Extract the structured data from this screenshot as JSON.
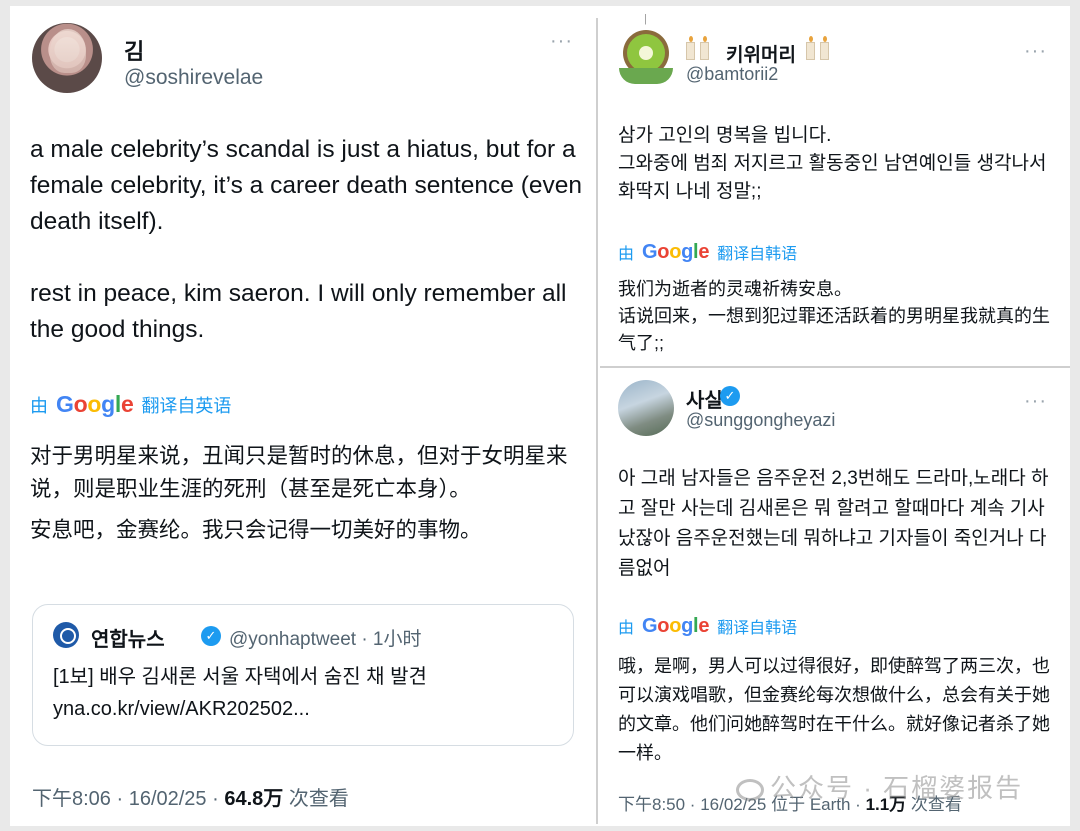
{
  "left_tweet": {
    "name": "김",
    "handle": "@soshirevelae",
    "more": "···",
    "body_en": [
      "a male celebrity’s scandal is just a hiatus, but for a female celebrity, it’s a career death sentence (even death itself).",
      "rest in peace, kim saeron. I will only remember all the good things."
    ],
    "translate_by": "由",
    "translate_from": "翻译自英语",
    "body_zh": [
      "对于男明星来说，丑闻只是暂时的休息，但对于女明星来说，则是职业生涯的死刑（甚至是死亡本身）。",
      "安息吧，金赛纶。我只会记得一切美好的事物。"
    ],
    "quote": {
      "name": "연합뉴스",
      "handle_time": "@yonhaptweet · 1小时",
      "line1": "[1보] 배우 김새론 서울 자택에서 숨진 채 발견",
      "line2": "yna.co.kr/view/AKR202502..."
    },
    "meta_time": "下午8:06 · 16/02/25 · ",
    "meta_views": "64.8万",
    "meta_views_label": " 次查看"
  },
  "right_top_tweet": {
    "name": "키위머리",
    "handle": "@bamtorii2",
    "more": "···",
    "body_ko": "삼가 고인의 명복을 빕니다.\n그와중에 범죄 저지르고 활동중인 남연예인들 생각나서 화딱지 나네 정말;;",
    "translate_by": "由",
    "translate_from": "翻译自韩语",
    "body_zh": "我们为逝者的灵魂祈祷安息。\n话说回来，一想到犯过罪还活跃着的男明星我就真的生气了;;"
  },
  "right_bottom_tweet": {
    "name": "사실",
    "handle": "@sunggongheyazi",
    "more": "···",
    "body_ko": "아 그래 남자들은 음주운전 2,3번해도 드라마,노래다 하고 잘만 사는데 김새론은 뭐 할려고 할때마다 계속 기사났잖아 음주운전했는데 뭐하냐고 기자들이 죽인거나 다름없어",
    "translate_by": "由",
    "translate_from": "翻译自韩语",
    "body_zh": "哦，是啊，男人可以过得很好，即使醉驾了两三次，也可以演戏唱歌，但金赛纶每次想做什么，总会有关于她的文章。他们问她醉驾时在干什么。就好像记者杀了她一样。",
    "meta_time": "下午8:50 · 16/02/25 位于 Earth · ",
    "meta_views": "1.1万",
    "meta_views_label": " 次查看"
  },
  "google_letters": [
    "G",
    "o",
    "o",
    "g",
    "l",
    "e"
  ],
  "verified_mark": "✓",
  "watermark": "公众号 · 石榴婆报告",
  "colors": {
    "link_blue": "#1d9bf0",
    "secondary_text": "#536471",
    "primary_text": "#0f1419"
  }
}
